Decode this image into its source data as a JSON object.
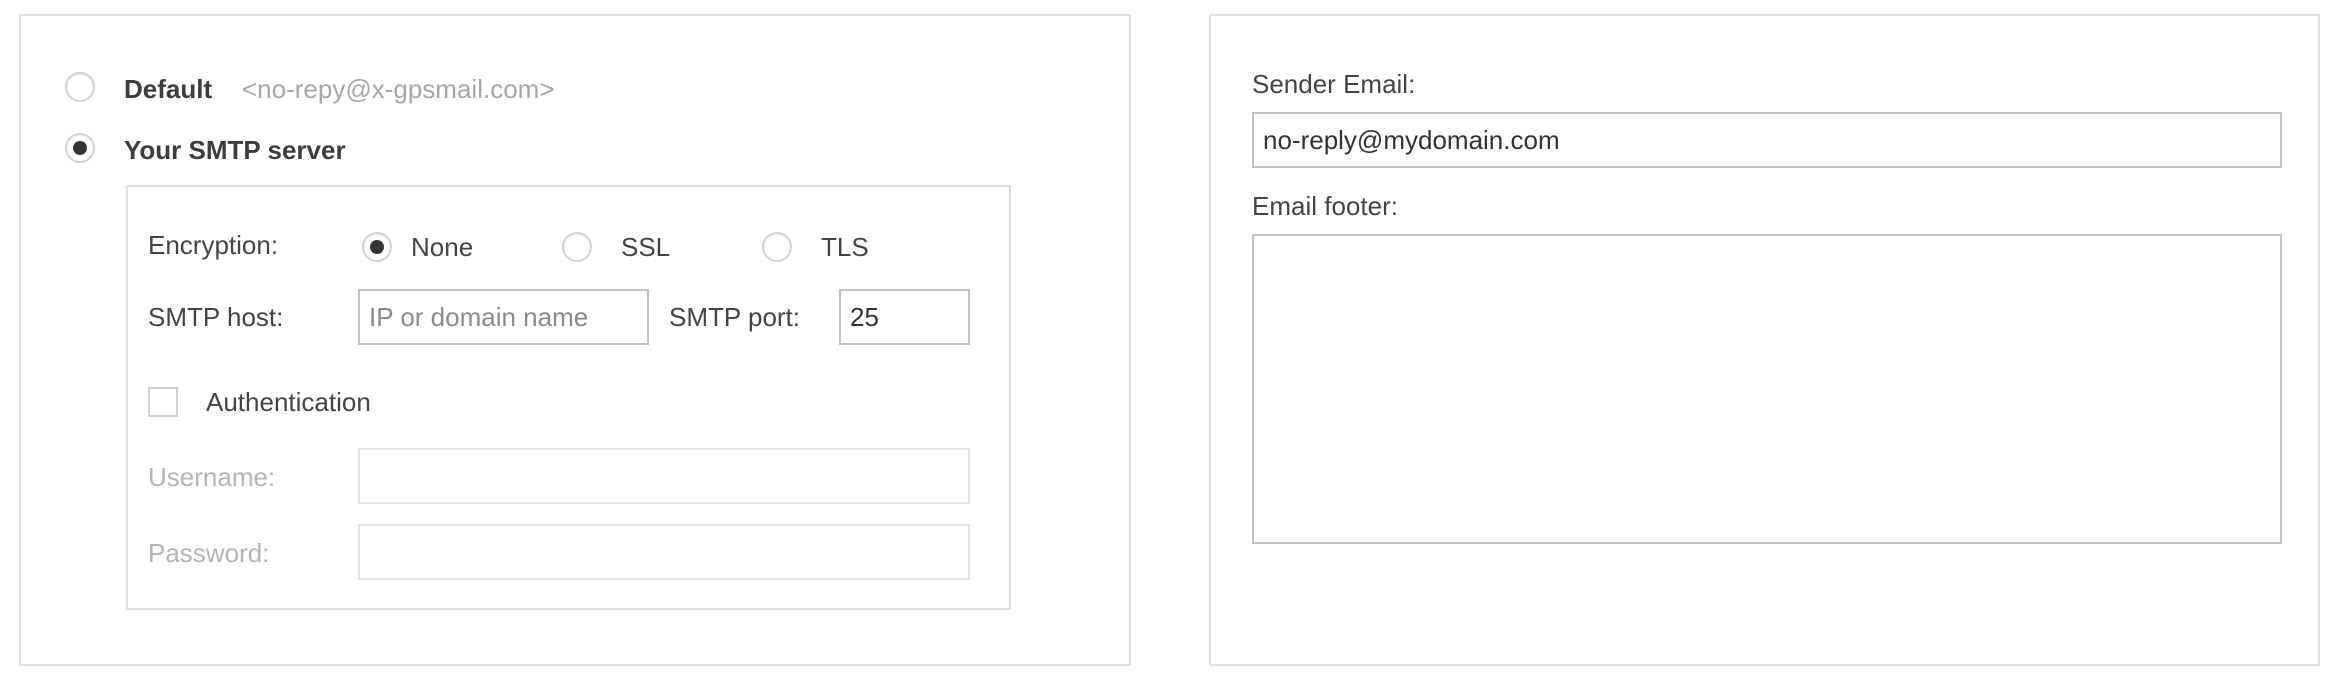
{
  "delivery": {
    "options": [
      {
        "label": "Default",
        "detail": "<no-repy@x-gpsmail.com>",
        "checked": false
      },
      {
        "label": "Your SMTP server",
        "checked": true
      }
    ]
  },
  "smtp": {
    "encryption_label": "Encryption:",
    "encryption_options": [
      {
        "label": "None",
        "checked": true
      },
      {
        "label": "SSL",
        "checked": false
      },
      {
        "label": "TLS",
        "checked": false
      }
    ],
    "host_label": "SMTP host:",
    "host_value": "",
    "host_placeholder": "IP or domain name",
    "port_label": "SMTP port:",
    "port_value": "25",
    "auth_label": "Authentication",
    "auth_checked": false,
    "username_label": "Username:",
    "username_value": "",
    "password_label": "Password:",
    "password_value": ""
  },
  "sender": {
    "email_label": "Sender Email:",
    "email_value": "no-reply@mydomain.com",
    "footer_label": "Email footer:",
    "footer_value": ""
  },
  "colors": {
    "text": "#444444",
    "muted": "#a6a6aa",
    "panel_border": "#e0e0e0",
    "input_border": "#c2c2c2"
  }
}
